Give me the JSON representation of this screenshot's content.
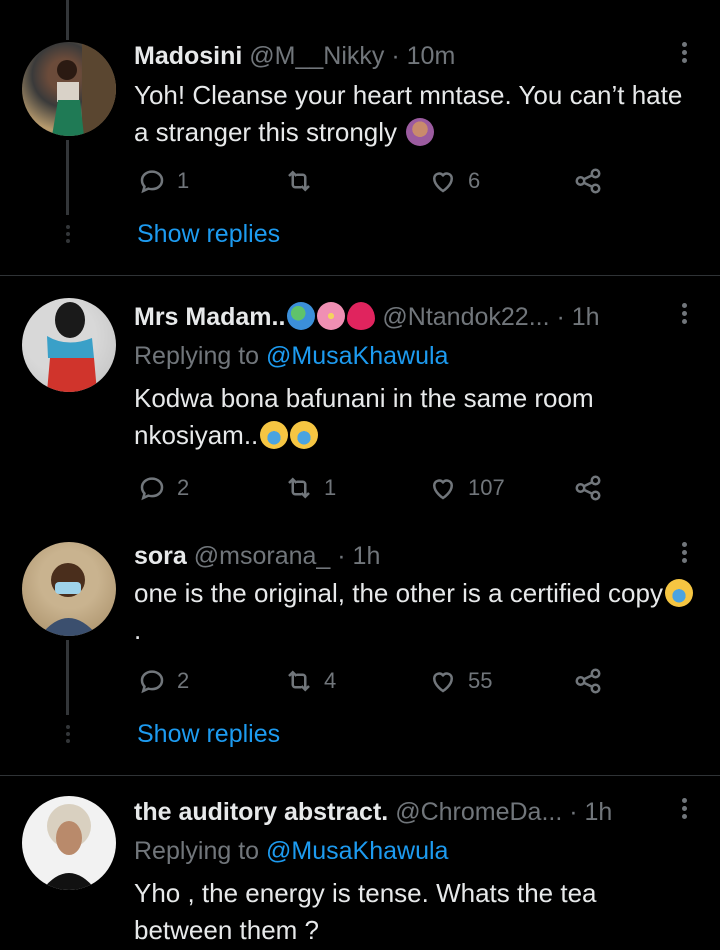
{
  "colors": {
    "background": "#000000",
    "text": "#e7e9ea",
    "muted": "#71767b",
    "accent": "#1d9bf0",
    "divider": "#2f3336"
  },
  "tweets": [
    {
      "name": "Madosini",
      "handle": "@M__Nikky",
      "time": "· 10m",
      "text": "Yoh! Cleanse your heart mntase. You can’t hate a stranger this strongly",
      "emoji": [
        "person-gesturing-no-emoji"
      ],
      "replies": "1",
      "retweets": "",
      "likes": "6",
      "show_replies": "Show replies"
    },
    {
      "name": "Mrs Madam..",
      "name_emoji": [
        "globe-emoji",
        "hibiscus-emoji",
        "red-heart-emoji"
      ],
      "handle": "@Ntandok22...",
      "time": "· 1h",
      "replying_prefix": "Replying to",
      "replying_to": "@MusaKhawula",
      "text": "Kodwa bona bafunani in the same room nkosiyam..",
      "emoji": [
        "crying-face-emoji",
        "crying-face-emoji"
      ],
      "replies": "2",
      "retweets": "1",
      "likes": "107"
    },
    {
      "name": "sora",
      "handle": "@msorana_",
      "time": "· 1h",
      "text": "one is the original, the other is a certified copy",
      "text_end": ".",
      "emoji": [
        "crying-face-emoji"
      ],
      "replies": "2",
      "retweets": "4",
      "likes": "55",
      "show_replies": "Show replies"
    },
    {
      "name": "the auditory abstract.",
      "handle": "@ChromeDa...",
      "time": "· 1h",
      "replying_prefix": "Replying to",
      "replying_to": "@MusaKhawula",
      "text": "Yho , the energy is tense. Whats the tea between them ?"
    }
  ]
}
